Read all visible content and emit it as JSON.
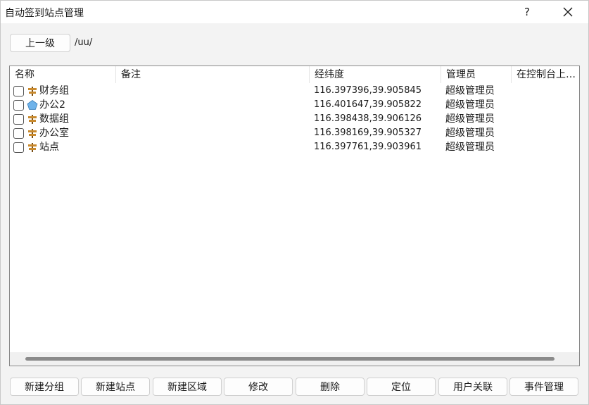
{
  "window": {
    "title": "自动签到站点管理",
    "help_label": "?"
  },
  "nav": {
    "up_label": "上一级",
    "path": "/uu/"
  },
  "list": {
    "columns": [
      "名称",
      "备注",
      "经纬度",
      "管理员",
      "在控制台上…"
    ],
    "rows": [
      {
        "name": "财务组",
        "icon": "group-signpost-icon",
        "remark": "",
        "coords": "116.397396,39.905845",
        "admin": "超级管理员"
      },
      {
        "name": "办公2",
        "icon": "area-pentagon-icon",
        "remark": "",
        "coords": "116.401647,39.905822",
        "admin": "超级管理员"
      },
      {
        "name": "数据组",
        "icon": "group-signpost-icon",
        "remark": "",
        "coords": "116.398438,39.906126",
        "admin": "超级管理员"
      },
      {
        "name": "办公室",
        "icon": "group-signpost-icon",
        "remark": "",
        "coords": "116.398169,39.905327",
        "admin": "超级管理员"
      },
      {
        "name": "站点",
        "icon": "group-signpost-icon",
        "remark": "",
        "coords": "116.397761,39.903961",
        "admin": "超级管理员"
      }
    ]
  },
  "buttons": {
    "new_group": "新建分组",
    "new_site": "新建站点",
    "new_area": "新建区域",
    "edit": "修改",
    "delete": "删除",
    "locate": "定位",
    "user_link": "用户关联",
    "event_manage": "事件管理"
  },
  "colors": {
    "signpost": "#c98a2e",
    "signpost_dark": "#7a4f14",
    "pentagon": "#6fb3ea"
  }
}
